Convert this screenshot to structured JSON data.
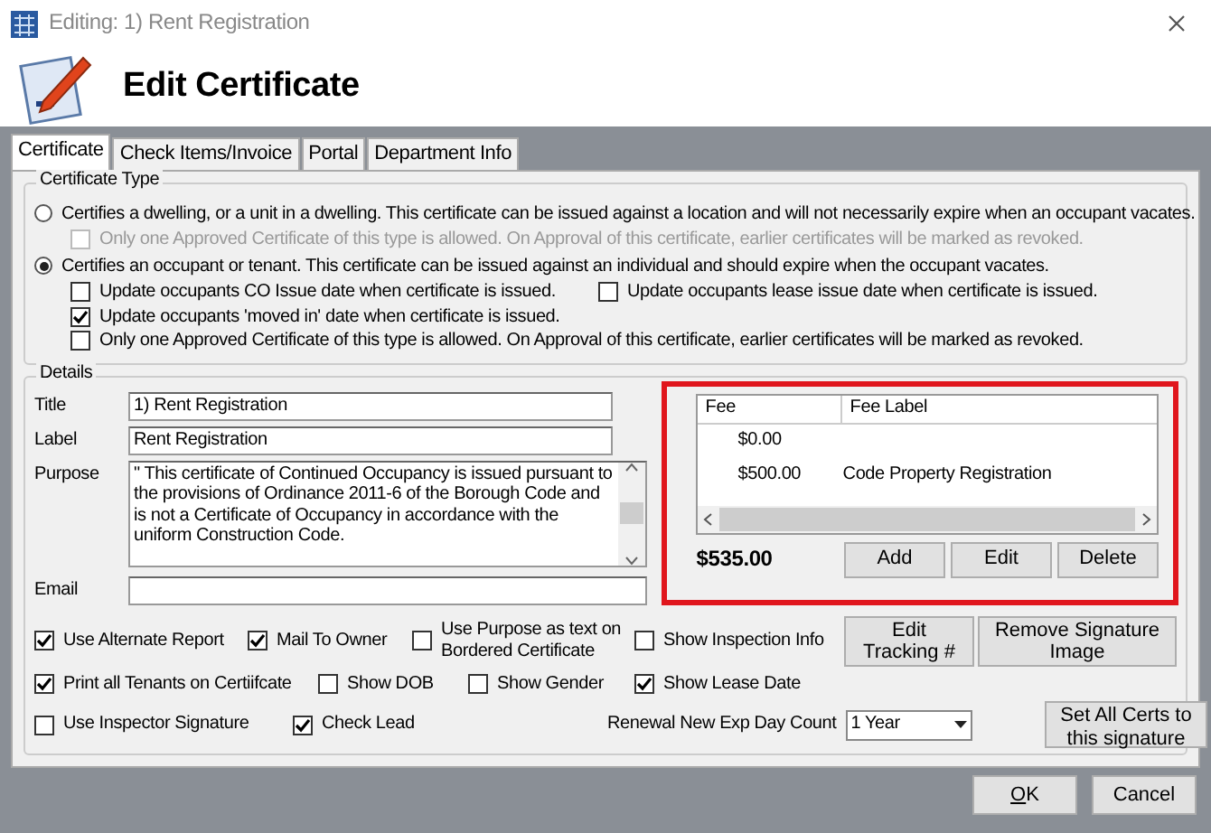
{
  "window": {
    "title": "Editing: 1) Rent Registration"
  },
  "header": {
    "title": "Edit Certificate"
  },
  "tabs": [
    {
      "label": "Certificate",
      "selected": true
    },
    {
      "label": "Check Items/Invoice",
      "selected": false
    },
    {
      "label": "Portal",
      "selected": false
    },
    {
      "label": "Department Info",
      "selected": false
    }
  ],
  "certificate_type": {
    "label": "Certificate Type",
    "options": [
      {
        "label": "Certifies a dwelling, or a unit in a dwelling. This certificate can be issued against a location and will not necessarily expire when an occupant vacates.",
        "selected": false,
        "children": [
          {
            "label": "Only one Approved Certificate of this type is allowed.  On Approval of this certificate, earlier certificates will be marked as revoked.",
            "checked": false,
            "disabled": true
          }
        ]
      },
      {
        "label": "Certifies an occupant or tenant. This certificate can be issued against an individual and should expire when the occupant vacates.",
        "selected": true,
        "children": [
          {
            "label": "Update occupants CO Issue date when certificate is issued.",
            "checked": false,
            "disabled": false
          },
          {
            "label": "Update occupants lease issue date when certificate is issued.",
            "checked": false,
            "disabled": false
          },
          {
            "label": "Update occupants 'moved in' date when certificate is issued.",
            "checked": true,
            "disabled": false
          },
          {
            "label": "Only one Approved Certificate of this type is allowed.  On Approval of this certificate, earlier certificates will be marked as revoked.",
            "checked": false,
            "disabled": false
          }
        ]
      }
    ]
  },
  "details": {
    "label": "Details",
    "fields": [
      {
        "kind": "text",
        "label": "Title",
        "value": "1) Rent Registration"
      },
      {
        "kind": "text",
        "label": "Label",
        "value": "Rent Registration"
      },
      {
        "kind": "textarea",
        "label": "Purpose",
        "value": "\" This certificate of Continued Occupancy is issued pursuant to the provisions of Ordinance 2011-6 of the Borough Code and is not a Certificate of Occupancy in accordance with the uniform Construction Code."
      },
      {
        "kind": "wide",
        "label": "Email"
      }
    ],
    "fees": {
      "highlighted": true,
      "columns": [
        "Fee",
        "Fee Label"
      ],
      "rows": [
        {
          "fee": "$0.00"
        },
        {
          "fee": "$500.00",
          "label": "Code Property Registration"
        }
      ],
      "total": "$535.00",
      "buttons": [
        "Add",
        "Edit",
        "Delete"
      ]
    },
    "option_rows": [
      [
        {
          "kind": "checkbox",
          "label": "Use Alternate Report",
          "checked": true
        },
        {
          "kind": "checkbox",
          "label": "Mail To Owner",
          "checked": true
        },
        {
          "kind": "checkbox",
          "label": "Use Purpose as text on Bordered Certificate",
          "checked": false
        },
        {
          "kind": "checkbox",
          "label": "Show Inspection Info",
          "checked": false
        },
        {
          "kind": "button",
          "label": "Edit Tracking #"
        },
        {
          "kind": "button",
          "label": "Remove Signature Image"
        }
      ],
      [
        {
          "kind": "checkbox",
          "label": "Print all Tenants on Certiifcate",
          "checked": true
        },
        {
          "kind": "checkbox",
          "label": "Show DOB",
          "checked": false
        },
        {
          "kind": "checkbox",
          "label": "Show Gender",
          "checked": false
        },
        {
          "kind": "checkbox",
          "label": "Show Lease Date",
          "checked": true
        }
      ],
      [
        {
          "kind": "checkbox",
          "label": "Use Inspector Signature",
          "checked": false
        },
        {
          "kind": "checkbox",
          "label": "Check Lead",
          "checked": true
        },
        {
          "kind": "select",
          "label": "Renewal New Exp Day Count",
          "value": "1 Year"
        },
        {
          "kind": "button",
          "label": "Set All Certs to this signature"
        }
      ]
    ]
  },
  "footer": {
    "buttons": [
      "OK",
      "Cancel"
    ]
  }
}
